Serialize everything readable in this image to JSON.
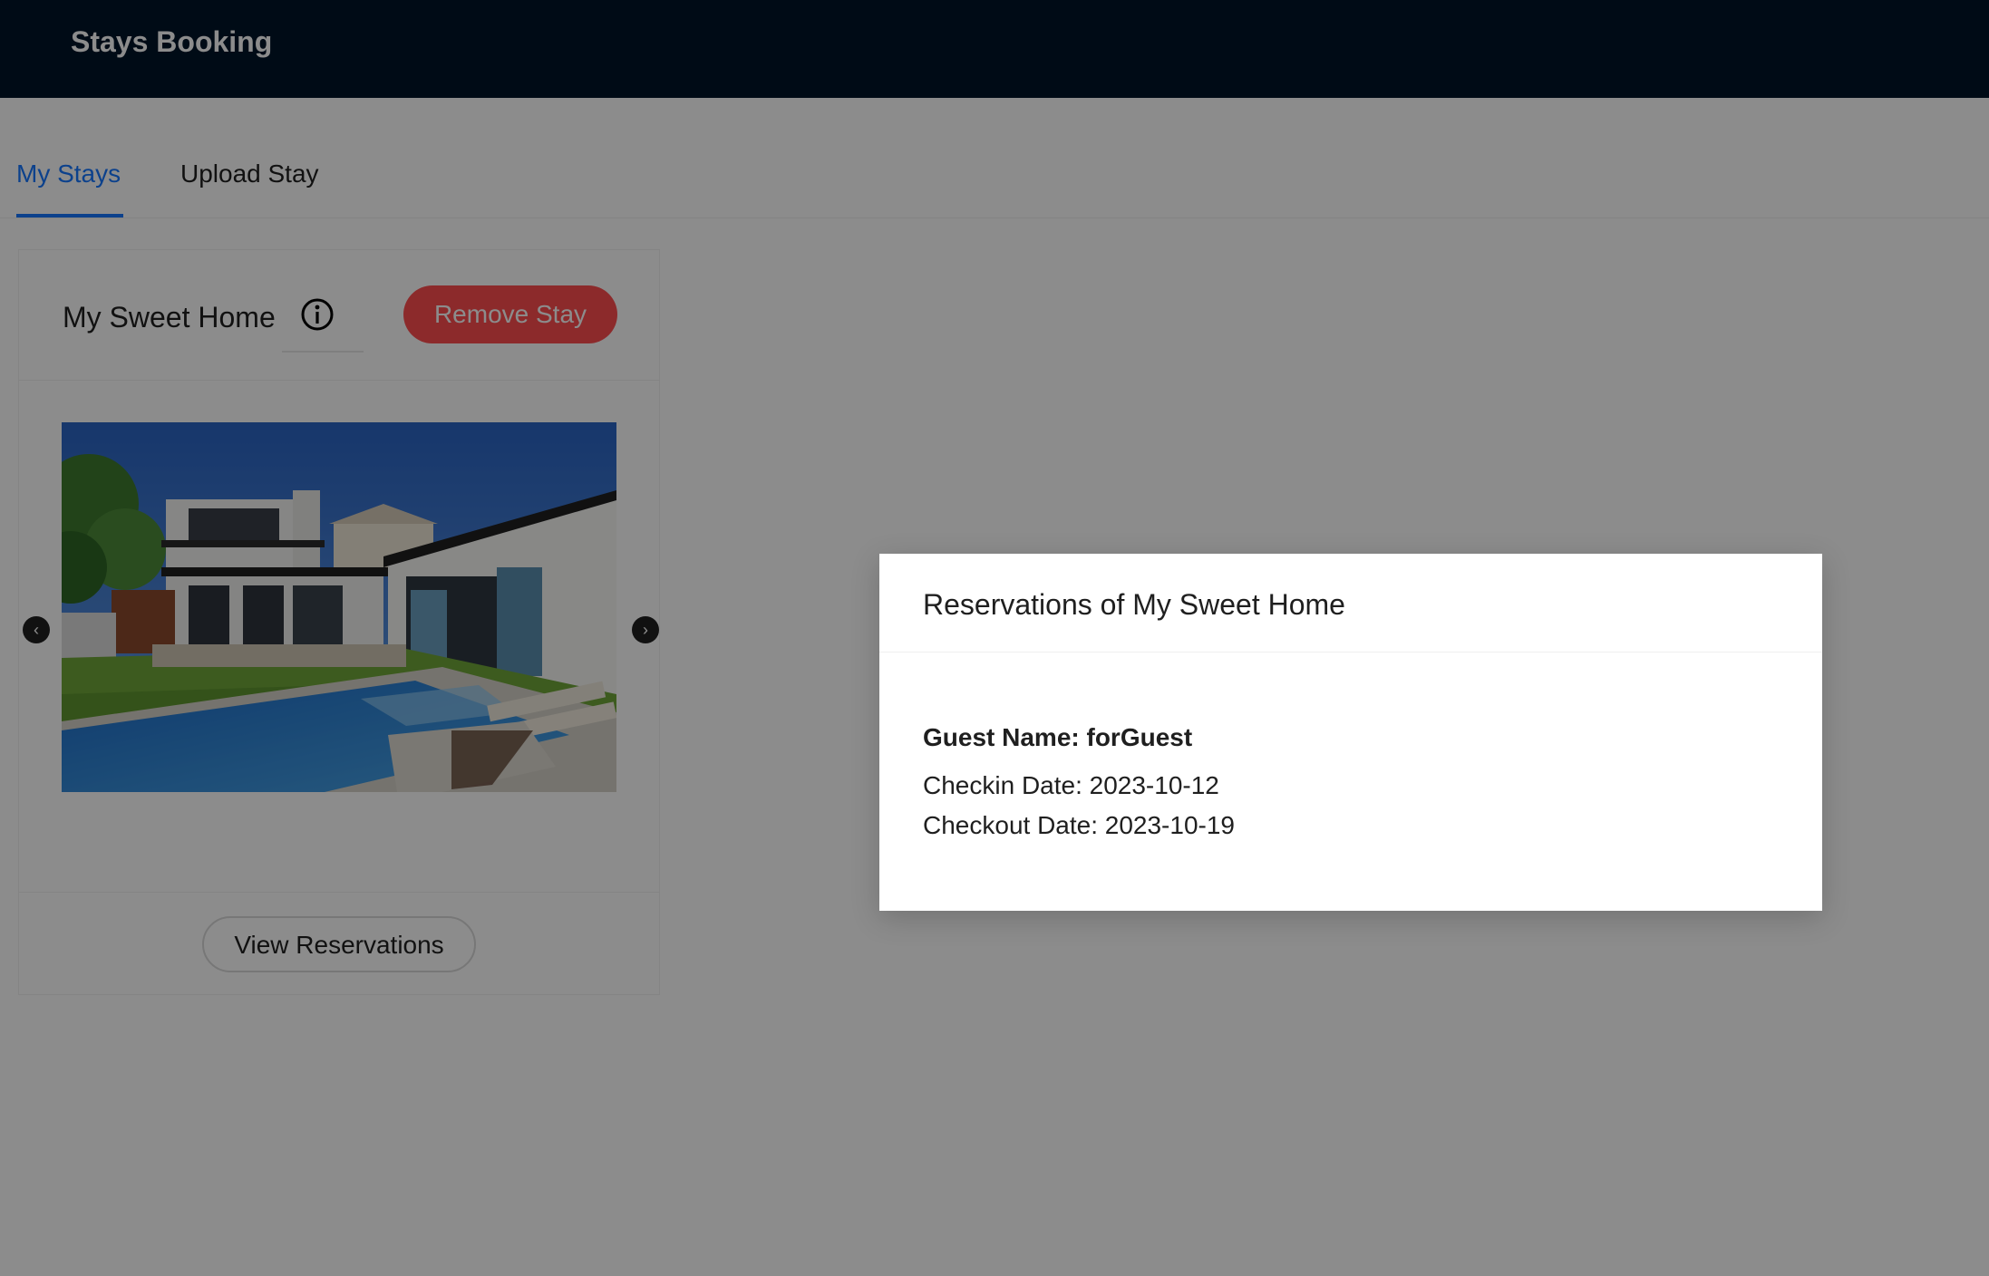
{
  "header": {
    "brand": "Stays Booking"
  },
  "tabs": [
    {
      "label": "My Stays",
      "active": true
    },
    {
      "label": "Upload Stay",
      "active": false
    }
  ],
  "stay_card": {
    "title": "My Sweet Home",
    "info_icon": "info-circle-icon",
    "remove_label": "Remove Stay",
    "carousel_prev_icon": "chevron-left-icon",
    "carousel_next_icon": "chevron-right-icon",
    "view_label": "View Reservations"
  },
  "modal": {
    "title": "Reservations of My Sweet Home",
    "reservations": [
      {
        "guest": "Guest Name: forGuest",
        "checkin": "Checkin Date: 2023-10-12",
        "checkout": "Checkout Date: 2023-10-19"
      }
    ]
  },
  "colors": {
    "header_bg": "#001529",
    "accent": "#1677ff",
    "danger": "#ff4d4f",
    "mask": "rgba(0,0,0,0.45)"
  }
}
